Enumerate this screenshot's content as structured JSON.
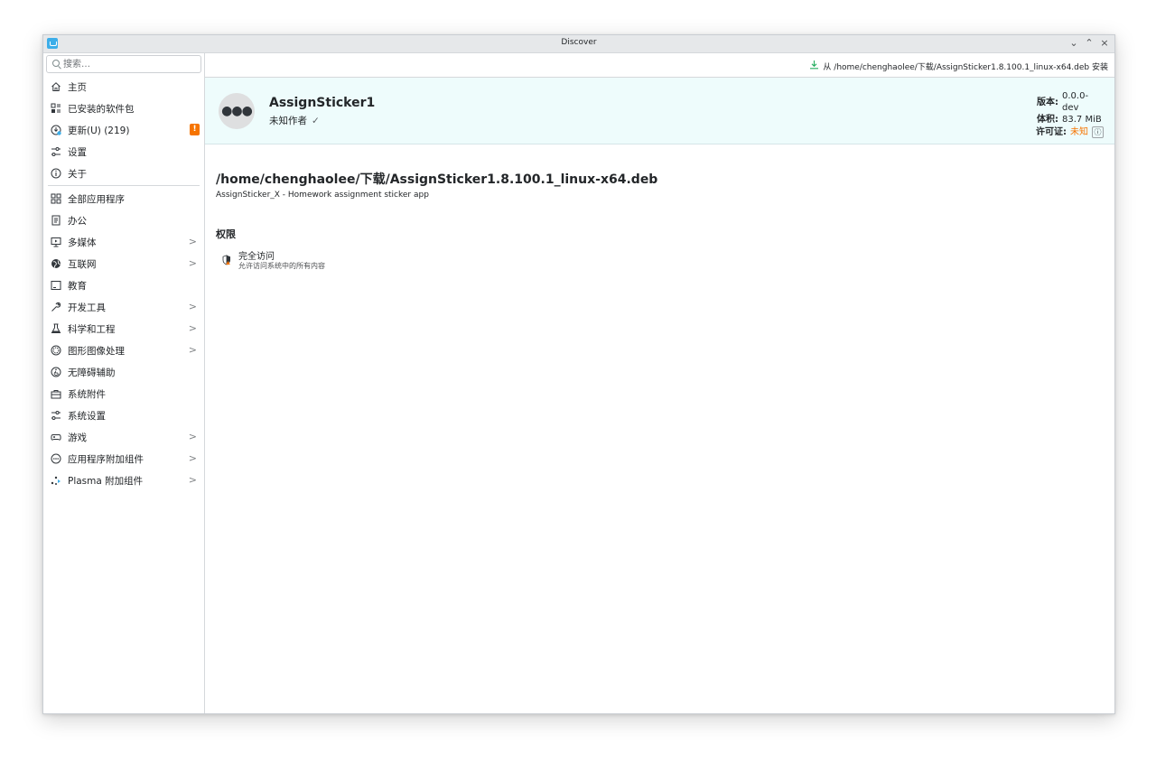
{
  "window": {
    "title": "Discover",
    "controls": {
      "minimize": "⌄",
      "maximize": "⌃",
      "close": "×"
    }
  },
  "search": {
    "placeholder": "搜索…",
    "value": ""
  },
  "sidebar": {
    "top_items": [
      {
        "label": "主页",
        "icon": "home-icon"
      },
      {
        "label": "已安装的软件包",
        "icon": "installed-icon"
      },
      {
        "label": "更新(U) (219)",
        "icon": "update-icon",
        "badge": "!"
      },
      {
        "label": "设置",
        "icon": "settings-icon"
      },
      {
        "label": "关于",
        "icon": "about-icon"
      }
    ],
    "categories": [
      {
        "label": "全部应用程序",
        "icon": "grid-icon",
        "has_children": false
      },
      {
        "label": "办公",
        "icon": "office-icon",
        "has_children": false
      },
      {
        "label": "多媒体",
        "icon": "multimedia-icon",
        "has_children": true
      },
      {
        "label": "互联网",
        "icon": "internet-icon",
        "has_children": true
      },
      {
        "label": "教育",
        "icon": "education-icon",
        "has_children": false
      },
      {
        "label": "开发工具",
        "icon": "dev-tools-icon",
        "has_children": true
      },
      {
        "label": "科学和工程",
        "icon": "science-icon",
        "has_children": true
      },
      {
        "label": "图形图像处理",
        "icon": "graphics-icon",
        "has_children": true
      },
      {
        "label": "无障碍辅助",
        "icon": "accessibility-icon",
        "has_children": false
      },
      {
        "label": "系统附件",
        "icon": "utilities-icon",
        "has_children": false
      },
      {
        "label": "系统设置",
        "icon": "system-settings-icon",
        "has_children": false
      },
      {
        "label": "游戏",
        "icon": "games-icon",
        "has_children": true
      },
      {
        "label": "应用程序附加组件",
        "icon": "addons-icon",
        "has_children": true
      },
      {
        "label": "Plasma 附加组件",
        "icon": "plasma-icon",
        "has_children": true
      }
    ]
  },
  "toolbar": {
    "install_label": "从 /home/chenghaolee/下载/AssignSticker1.8.100.1_linux-x64.deb 安装"
  },
  "package": {
    "name": "AssignSticker1",
    "author": "未知作者",
    "version_label": "版本:",
    "version": "0.0.0-dev",
    "size_label": "体积:",
    "size": "83.7 MiB",
    "license_label": "许可证:",
    "license": "未知",
    "path": "/home/chenghaolee/下载/AssignSticker1.8.100.1_linux-x64.deb",
    "description": "AssignSticker_X - Homework assignment sticker app"
  },
  "permissions": {
    "heading": "权限",
    "items": [
      {
        "title": "完全访问",
        "description": "允许访问系统中的所有内容"
      }
    ]
  },
  "colors": {
    "accent": "#3daee9",
    "header_band": "#eefcfc",
    "warning": "#f67400",
    "download": "#27ae60"
  }
}
